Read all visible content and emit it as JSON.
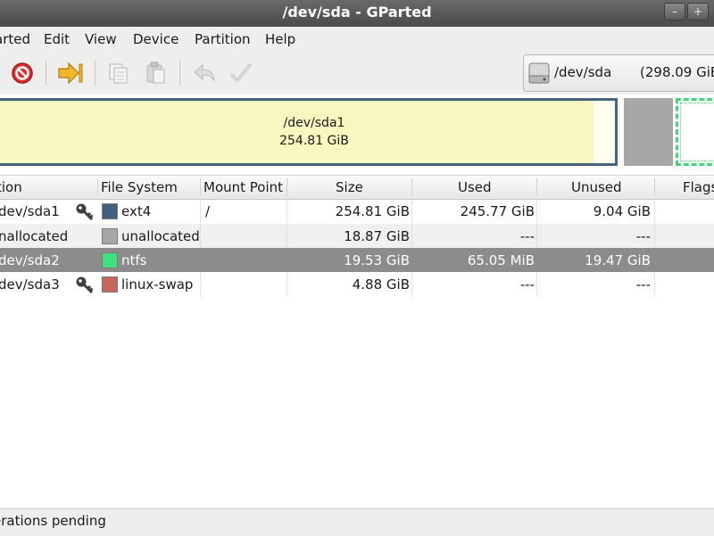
{
  "window": {
    "title": "/dev/sda - GParted"
  },
  "menubar": {
    "items": [
      "arted",
      "Edit",
      "View",
      "Device",
      "Partition",
      "Help"
    ]
  },
  "toolbar": {
    "device": {
      "name": "/dev/sda",
      "size": "(298.09 GiB"
    }
  },
  "disk_graphic": {
    "selected_segment": {
      "name": "/dev/sda1",
      "size": "254.81 GiB"
    }
  },
  "table": {
    "headers": [
      "tion",
      "File System",
      "Mount Point",
      "Size",
      "Used",
      "Unused",
      "Flags"
    ],
    "rows": [
      {
        "partition": "dev/sda1",
        "fs": "ext4",
        "fs_color": "#42607f",
        "mount": "/",
        "size": "254.81 GiB",
        "used": "245.77 GiB",
        "unused": "9.04 GiB",
        "key": true
      },
      {
        "partition": "nallocated",
        "fs": "unallocated",
        "fs_color": "#a7a7a7",
        "mount": "",
        "size": "18.87 GiB",
        "used": "---",
        "unused": "---",
        "key": false
      },
      {
        "partition": "dev/sda2",
        "fs": "ntfs",
        "fs_color": "#40e080",
        "mount": "",
        "size": "19.53 GiB",
        "used": "65.05 MiB",
        "unused": "19.47 GiB",
        "key": false
      },
      {
        "partition": "dev/sda3",
        "fs": "linux-swap",
        "fs_color": "#c8655a",
        "mount": "",
        "size": "4.88 GiB",
        "used": "---",
        "unused": "---",
        "key": true
      }
    ]
  },
  "statusbar": {
    "text": "erations pending"
  },
  "icons": {
    "cancel": "cancel-icon",
    "apply": "apply-icon",
    "copy": "copy-icon",
    "paste": "paste-icon",
    "undo": "undo-icon",
    "check": "check-icon",
    "disk": "hard-disk-icon",
    "key": "key-icon"
  }
}
